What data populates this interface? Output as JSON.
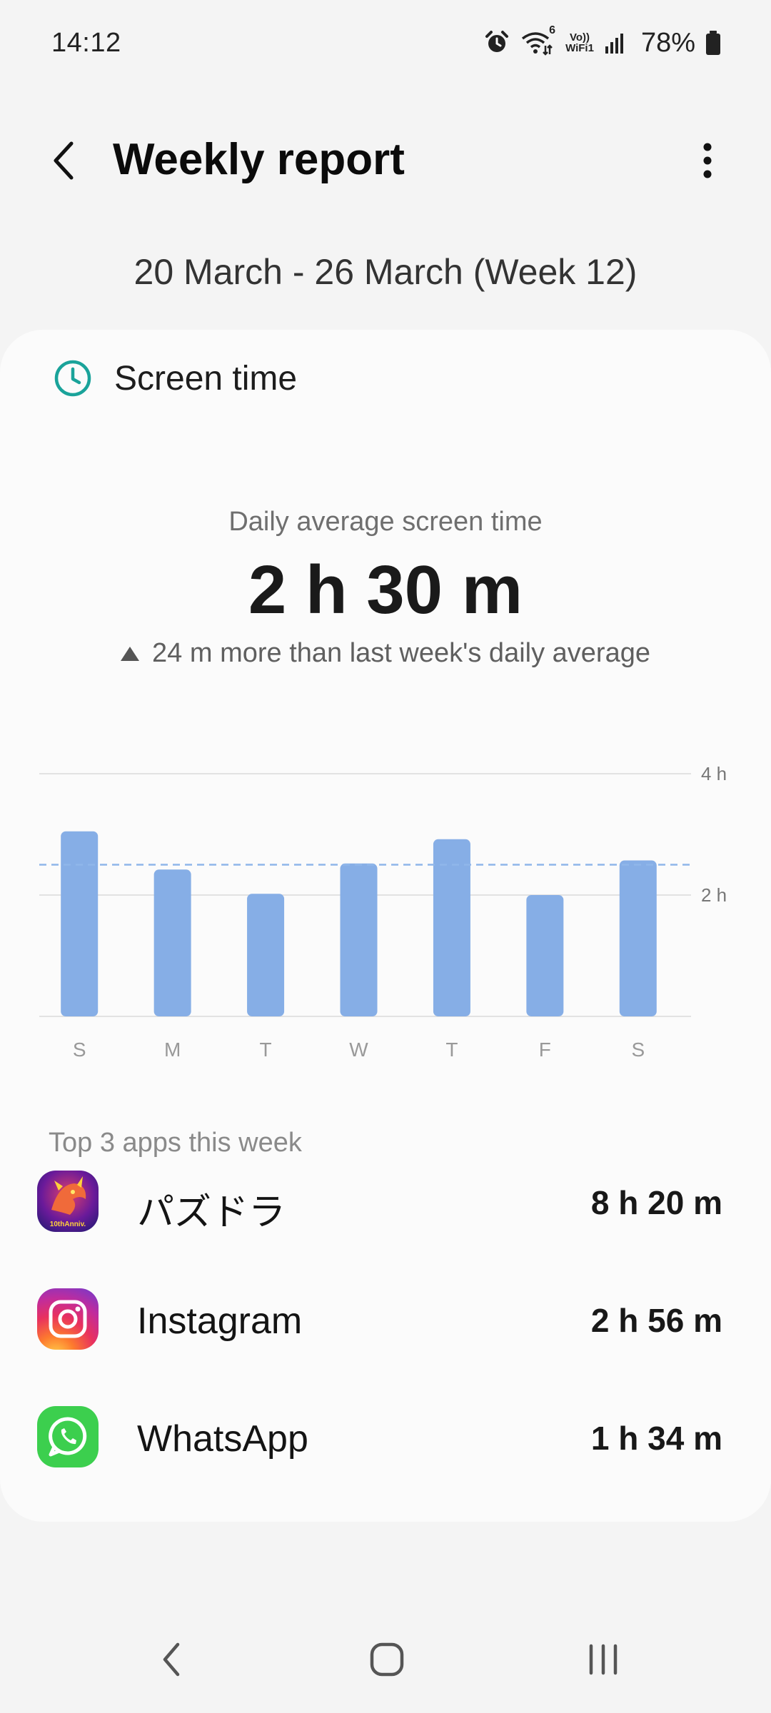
{
  "status_bar": {
    "time": "14:12",
    "battery": "78%",
    "icons": [
      "alarm-icon",
      "wifi-icon",
      "volte-wifi-icon",
      "signal-icon",
      "battery-icon"
    ],
    "wifi_badge": "6",
    "volte_top": "Vo))",
    "volte_bottom": "WiFi1"
  },
  "header": {
    "title": "Weekly report",
    "back_icon": "back-arrow-icon",
    "more_icon": "more-vertical-icon"
  },
  "date_range": "20 March - 26 March (Week 12)",
  "screen_time": {
    "title": "Screen time",
    "icon": "clock-icon",
    "avg_label": "Daily average screen time",
    "avg_value": "2 h 30 m",
    "compare_text": "24 m more than last week's daily average",
    "compare_icon": "up-triangle-icon"
  },
  "chart_data": {
    "type": "bar",
    "categories": [
      "S",
      "M",
      "T",
      "W",
      "T",
      "F",
      "S"
    ],
    "values": [
      3.05,
      2.42,
      2.02,
      2.52,
      2.92,
      2.0,
      2.57
    ],
    "unit": "h",
    "ylim": [
      0,
      4
    ],
    "yticks": [
      {
        "value": 2,
        "label": "2 h"
      },
      {
        "value": 4,
        "label": "4 h"
      }
    ],
    "average_line": 2.5,
    "bar_color": "#86aee6",
    "avg_line_color": "#8fb6ea",
    "grid": true
  },
  "top_apps": {
    "label": "Top 3 apps this week",
    "apps": [
      {
        "name": "パズドラ",
        "time": "8 h 20 m",
        "icon": "puzzle-dragons-icon",
        "icon_badge": "10thAnniv."
      },
      {
        "name": "Instagram",
        "time": "2 h 56 m",
        "icon": "instagram-icon"
      },
      {
        "name": "WhatsApp",
        "time": "1 h 34 m",
        "icon": "whatsapp-icon"
      }
    ]
  },
  "nav_bar": {
    "icons": [
      "nav-back-icon",
      "nav-home-icon",
      "nav-recents-icon"
    ]
  },
  "colors": {
    "accent_teal": "#1aa39a",
    "background": "#f4f4f4",
    "card": "#fbfbfb"
  }
}
